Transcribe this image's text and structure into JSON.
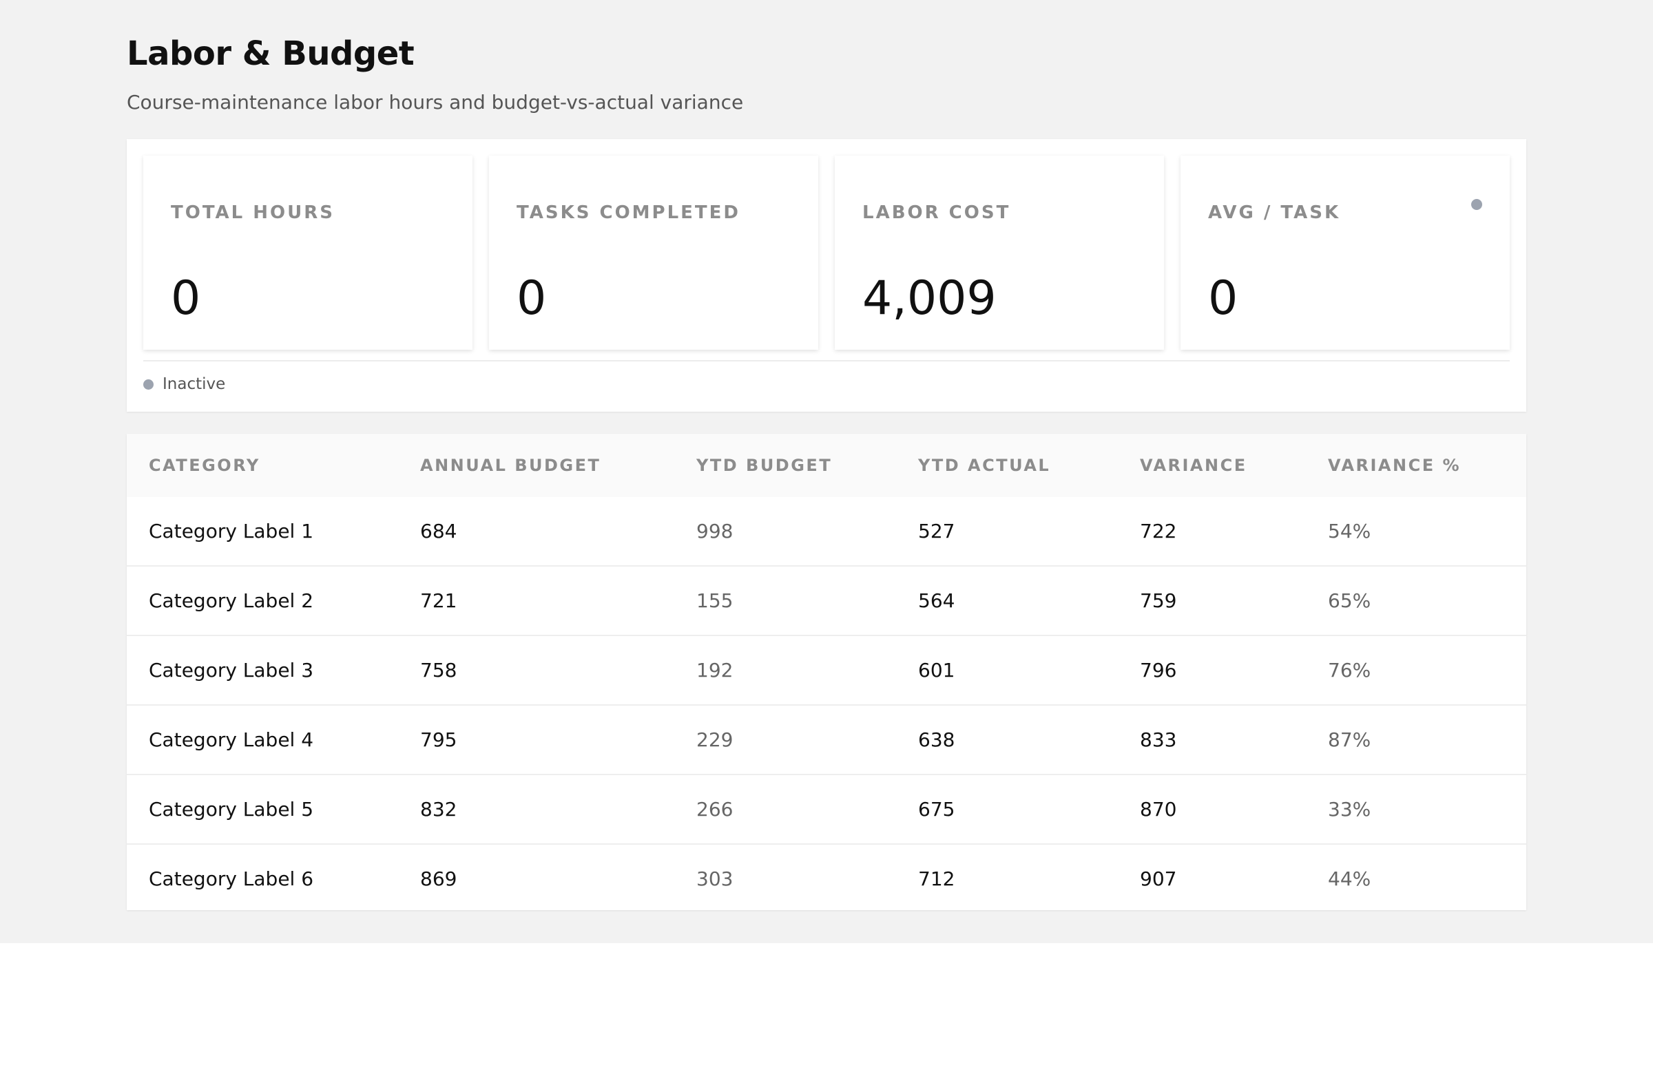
{
  "page": {
    "title": "Labor & Budget",
    "subtitle": "Course-maintenance labor hours and budget-vs-actual variance"
  },
  "stats": {
    "cards": [
      {
        "label": "TOTAL HOURS",
        "value": "0"
      },
      {
        "label": "TASKS COMPLETED",
        "value": "0"
      },
      {
        "label": "LABOR COST",
        "value": "4,009"
      },
      {
        "label": "AVG / TASK",
        "value": "0"
      }
    ],
    "status": "Inactive",
    "status_color": "#9ca3af"
  },
  "table": {
    "headers": [
      "CATEGORY",
      "ANNUAL BUDGET",
      "YTD BUDGET",
      "YTD ACTUAL",
      "VARIANCE",
      "VARIANCE %"
    ],
    "rows": [
      [
        "Category Label 1",
        "684",
        "998",
        "527",
        "722",
        "54%"
      ],
      [
        "Category Label 2",
        "721",
        "155",
        "564",
        "759",
        "65%"
      ],
      [
        "Category Label 3",
        "758",
        "192",
        "601",
        "796",
        "76%"
      ],
      [
        "Category Label 4",
        "795",
        "229",
        "638",
        "833",
        "87%"
      ],
      [
        "Category Label 5",
        "832",
        "266",
        "675",
        "870",
        "33%"
      ],
      [
        "Category Label 6",
        "869",
        "303",
        "712",
        "907",
        "44%"
      ]
    ]
  }
}
